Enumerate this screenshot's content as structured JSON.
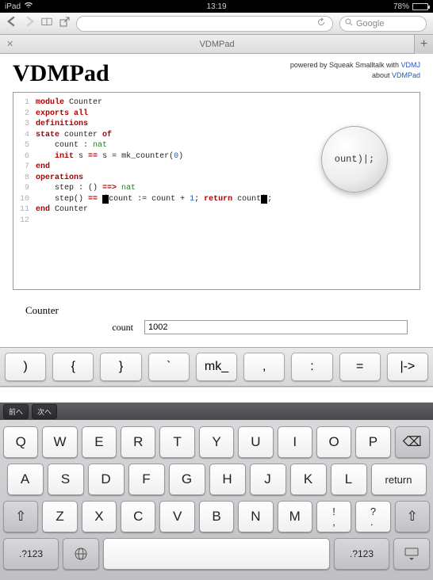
{
  "status": {
    "carrier": "iPad",
    "time": "13:19",
    "battery_pct": "78%"
  },
  "browser": {
    "search_placeholder": "Google",
    "tab_title": "VDMPad"
  },
  "page": {
    "title": "VDMPad",
    "credit_prefix": "powered by Squeak Smalltalk with ",
    "credit_link1": "VDMJ",
    "credit_about": "about ",
    "credit_link2": "VDMPad"
  },
  "code": {
    "lines": [
      {
        "n": "1",
        "tokens": [
          [
            "kw",
            "module"
          ],
          [
            "txt",
            " Counter"
          ]
        ]
      },
      {
        "n": "2",
        "tokens": [
          [
            "kw",
            "exports"
          ],
          [
            "txt",
            " "
          ],
          [
            "kw",
            "all"
          ]
        ]
      },
      {
        "n": "3",
        "tokens": [
          [
            "kw",
            "definitions"
          ]
        ]
      },
      {
        "n": "4",
        "tokens": [
          [
            "kw",
            "state"
          ],
          [
            "txt",
            " counter "
          ],
          [
            "kw",
            "of"
          ]
        ]
      },
      {
        "n": "5",
        "tokens": [
          [
            "txt",
            "    count : "
          ],
          [
            "type",
            "nat"
          ]
        ]
      },
      {
        "n": "6",
        "tokens": [
          [
            "txt",
            "    "
          ],
          [
            "kw",
            "init"
          ],
          [
            "txt",
            " s "
          ],
          [
            "kw",
            "=="
          ],
          [
            "txt",
            " s = mk_counter("
          ],
          [
            "num",
            "0"
          ],
          [
            "txt",
            ")"
          ]
        ]
      },
      {
        "n": "7",
        "tokens": [
          [
            "kw",
            "end"
          ]
        ]
      },
      {
        "n": "8",
        "tokens": [
          [
            "kw",
            "operations"
          ]
        ]
      },
      {
        "n": "9",
        "tokens": [
          [
            "txt",
            "    step : () "
          ],
          [
            "kw",
            "==>"
          ],
          [
            "txt",
            " "
          ],
          [
            "type",
            "nat"
          ]
        ]
      },
      {
        "n": "10",
        "tokens": [
          [
            "txt",
            "    step() "
          ],
          [
            "kw",
            "=="
          ],
          [
            "txt",
            " "
          ],
          [
            "cur",
            "("
          ],
          [
            "txt",
            "count := count + "
          ],
          [
            "num",
            "1"
          ],
          [
            "txt",
            "; "
          ],
          [
            "kw",
            "return"
          ],
          [
            "txt",
            " count"
          ],
          [
            "cur",
            ")"
          ],
          [
            "txt",
            ";"
          ]
        ]
      },
      {
        "n": "11",
        "tokens": [
          [
            "kw",
            "end"
          ],
          [
            "txt",
            " Counter"
          ]
        ]
      },
      {
        "n": "12",
        "tokens": []
      }
    ]
  },
  "magnifier": "ount)|;",
  "results": {
    "heading": "Counter",
    "label": "count",
    "value": "1002"
  },
  "symbol_keys": [
    ")",
    "{",
    "}",
    "`",
    "mk_",
    ",",
    ":",
    "=",
    "|->"
  ],
  "kb_access": [
    "前へ",
    "次へ"
  ],
  "keyboard": {
    "row1": [
      "Q",
      "W",
      "E",
      "R",
      "T",
      "Y",
      "U",
      "I",
      "O",
      "P"
    ],
    "row2": [
      "A",
      "S",
      "D",
      "F",
      "G",
      "H",
      "J",
      "K",
      "L"
    ],
    "row2_return": "return",
    "row3": [
      "Z",
      "X",
      "C",
      "V",
      "B",
      "N",
      "M"
    ],
    "row3_punct": [
      "!\n,",
      "?\n."
    ],
    "row4_mode": ".?123",
    "row4_mode2": ".?123"
  }
}
